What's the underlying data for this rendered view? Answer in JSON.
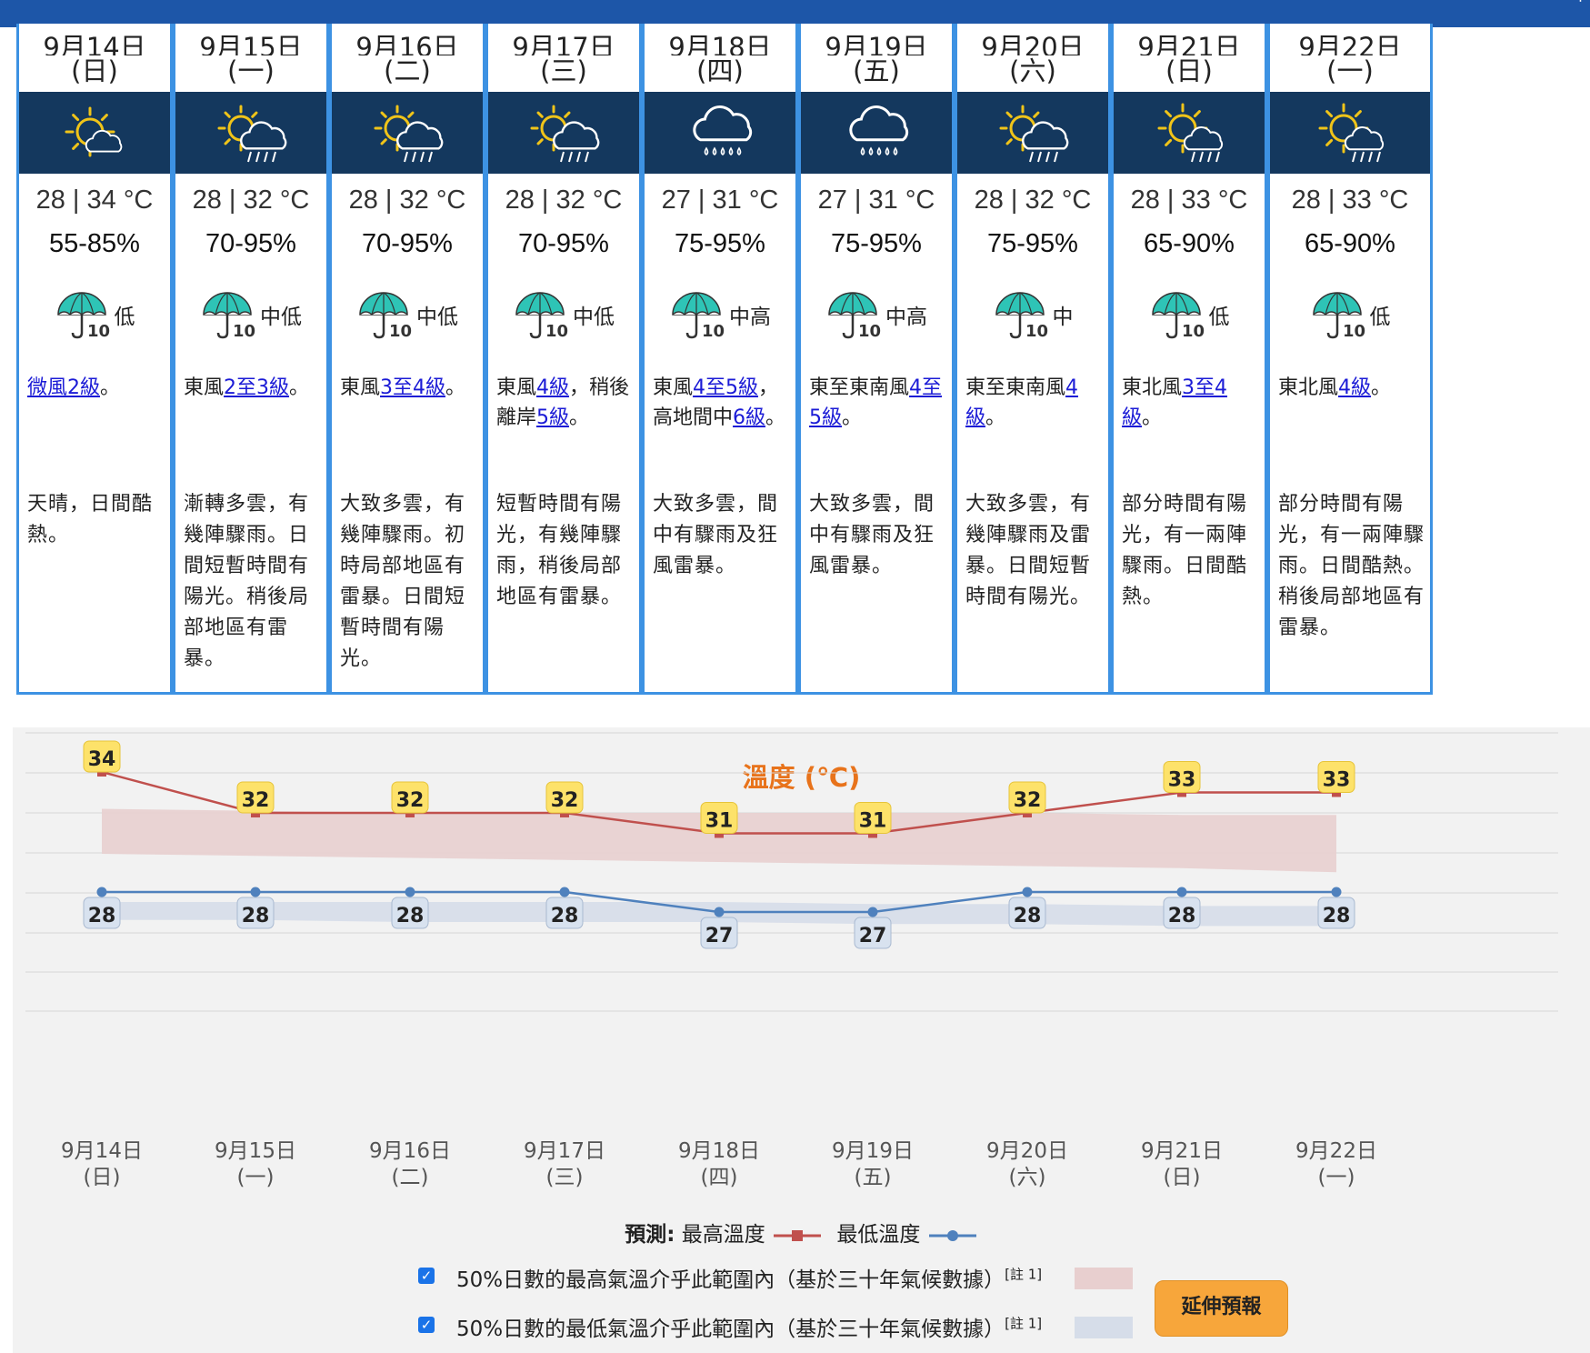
{
  "days": [
    {
      "date": "9月14日",
      "weekday": "(日)",
      "icon": "sunny-periods-icon",
      "temp": "28 | 34 °C",
      "humidity": "55-85%",
      "psr": "低",
      "wind": [
        {
          "t": "微風2級",
          "link": true
        },
        {
          "t": "。",
          "link": false
        }
      ],
      "desc": "天晴，日間酷熱。"
    },
    {
      "date": "9月15日",
      "weekday": "(一)",
      "icon": "sunny-periods-with-showers-icon",
      "temp": "28 | 32 °C",
      "humidity": "70-95%",
      "psr": "中低",
      "wind": [
        {
          "t": "東風",
          "link": false
        },
        {
          "t": "2至3級",
          "link": true
        },
        {
          "t": "。",
          "link": false
        }
      ],
      "desc": "漸轉多雲，有幾陣驟雨。日間短暫時間有陽光。稍後局部地區有雷暴。"
    },
    {
      "date": "9月16日",
      "weekday": "(二)",
      "icon": "sunny-periods-with-showers-icon",
      "temp": "28 | 32 °C",
      "humidity": "70-95%",
      "psr": "中低",
      "wind": [
        {
          "t": "東風",
          "link": false
        },
        {
          "t": "3至4級",
          "link": true
        },
        {
          "t": "。",
          "link": false
        }
      ],
      "desc": "大致多雲，有幾陣驟雨。初時局部地區有雷暴。日間短暫時間有陽光。"
    },
    {
      "date": "9月17日",
      "weekday": "(三)",
      "icon": "sunny-periods-with-showers-icon",
      "temp": "28 | 32 °C",
      "humidity": "70-95%",
      "psr": "中低",
      "wind": [
        {
          "t": "東風",
          "link": false
        },
        {
          "t": "4級",
          "link": true
        },
        {
          "t": "，稍後離岸",
          "link": false
        },
        {
          "t": "5級",
          "link": true
        },
        {
          "t": "。",
          "link": false
        }
      ],
      "desc": "短暫時間有陽光，有幾陣驟雨，稍後局部地區有雷暴。"
    },
    {
      "date": "9月18日",
      "weekday": "(四)",
      "icon": "heavy-showers-icon",
      "temp": "27 | 31 °C",
      "humidity": "75-95%",
      "psr": "中高",
      "wind": [
        {
          "t": "東風",
          "link": false
        },
        {
          "t": "4至5級",
          "link": true
        },
        {
          "t": "，高地間中",
          "link": false
        },
        {
          "t": "6級",
          "link": true
        },
        {
          "t": "。",
          "link": false
        }
      ],
      "desc": "大致多雲，間中有驟雨及狂風雷暴。"
    },
    {
      "date": "9月19日",
      "weekday": "(五)",
      "icon": "heavy-showers-icon",
      "temp": "27 | 31 °C",
      "humidity": "75-95%",
      "psr": "中高",
      "wind": [
        {
          "t": "東至東南風",
          "link": false
        },
        {
          "t": "4至5級",
          "link": true
        },
        {
          "t": "。",
          "link": false
        }
      ],
      "desc": "大致多雲，間中有驟雨及狂風雷暴。"
    },
    {
      "date": "9月20日",
      "weekday": "(六)",
      "icon": "sunny-periods-with-showers-icon",
      "temp": "28 | 32 °C",
      "humidity": "75-95%",
      "psr": "中",
      "wind": [
        {
          "t": "東至東南風",
          "link": false
        },
        {
          "t": "4級",
          "link": true
        },
        {
          "t": "。",
          "link": false
        }
      ],
      "desc": "大致多雲，有幾陣驟雨及雷暴。日間短暫時間有陽光。"
    },
    {
      "date": "9月21日",
      "weekday": "(日)",
      "icon": "sunny-intervals-with-showers-icon",
      "temp": "28 | 33 °C",
      "humidity": "65-90%",
      "psr": "低",
      "wind": [
        {
          "t": "東北風",
          "link": false
        },
        {
          "t": "3至4級",
          "link": true
        },
        {
          "t": "。",
          "link": false
        }
      ],
      "desc": "部分時間有陽光，有一兩陣驟雨。日間酷熱。"
    },
    {
      "date": "9月22日",
      "weekday": "(一)",
      "icon": "sunny-intervals-with-showers-icon",
      "temp": "28 | 33 °C",
      "humidity": "65-90%",
      "psr": "低",
      "wind": [
        {
          "t": "東北風",
          "link": false
        },
        {
          "t": "4級",
          "link": true
        },
        {
          "t": "。",
          "link": false
        }
      ],
      "desc": "部分時間有陽光，有一兩陣驟雨。日間酷熱。稍後局部地區有雷暴。"
    }
  ],
  "psr_icon_number": "10",
  "chart_data": {
    "type": "line",
    "title": "溫度 (℃)",
    "categories": [
      "9月14日\n(日)",
      "9月15日\n(一)",
      "9月16日\n(二)",
      "9月17日\n(三)",
      "9月18日\n(四)",
      "9月19日\n(五)",
      "9月20日\n(六)",
      "9月21日\n(日)",
      "9月22日\n(一)"
    ],
    "series": [
      {
        "name": "最高溫度",
        "values": [
          34,
          32,
          32,
          32,
          31,
          31,
          32,
          33,
          33
        ],
        "color": "#c0504d"
      },
      {
        "name": "最低溫度",
        "values": [
          28,
          28,
          28,
          28,
          27,
          27,
          28,
          28,
          28
        ],
        "color": "#4f81bd"
      }
    ],
    "bands": [
      {
        "name": "50%日數的最高氣溫介乎此範圍內（基於三十年氣候數據）",
        "low": [
          30,
          29.9,
          29.8,
          29.7,
          29.6,
          29.5,
          29.4,
          29.3,
          29.1
        ],
        "high": [
          32.2,
          32.1,
          32.0,
          32.0,
          32.0,
          32.0,
          32.0,
          31.9,
          31.9
        ],
        "color": "#e8cfcf"
      },
      {
        "name": "50%日數的最低氣溫介乎此範圍內（基於三十年氣候數據）",
        "low": [
          26.6,
          26.6,
          26.5,
          26.5,
          26.5,
          26.4,
          26.4,
          26.3,
          26.3
        ],
        "high": [
          27.5,
          27.5,
          27.5,
          27.5,
          27.5,
          27.4,
          27.4,
          27.3,
          27.3
        ],
        "color": "#d6dde9"
      }
    ],
    "ylim": [
      25,
      36
    ],
    "grid": true,
    "legend_prefix": "預測:"
  },
  "legend": {
    "forecast_label": "預測:",
    "max_label": "最高溫度",
    "min_label": "最低溫度",
    "climo_max_text": "50%日數的最高氣溫介乎此範圍內（基於三十年氣候數據）",
    "climo_min_text": "50%日數的最低氣溫介乎此範圍內（基於三十年氣候數據）",
    "note": "[註 1]"
  },
  "extend_button_label": "延伸預報",
  "colors": {
    "header_bar": "#1d56a8",
    "card_border": "#3d92e3",
    "icon_band": "#14385e",
    "title": "#e8731b",
    "button": "#f7a63b"
  }
}
